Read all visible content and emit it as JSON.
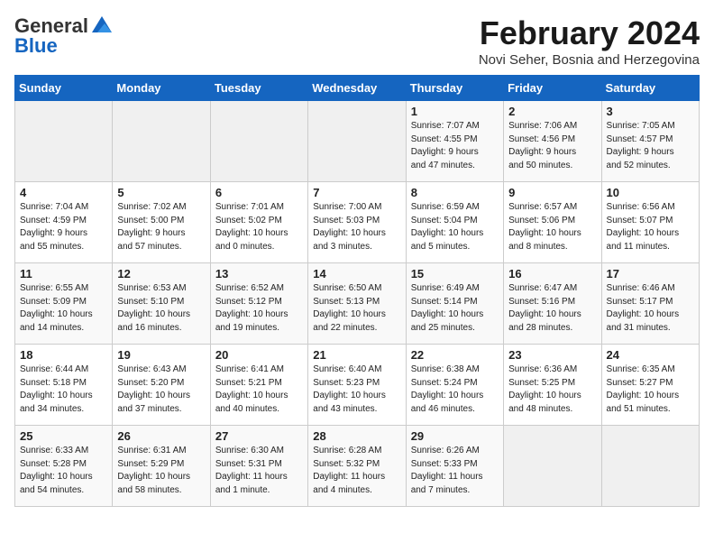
{
  "header": {
    "logo_general": "General",
    "logo_blue": "Blue",
    "month_title": "February 2024",
    "location": "Novi Seher, Bosnia and Herzegovina"
  },
  "days_of_week": [
    "Sunday",
    "Monday",
    "Tuesday",
    "Wednesday",
    "Thursday",
    "Friday",
    "Saturday"
  ],
  "weeks": [
    [
      {
        "day": "",
        "info": ""
      },
      {
        "day": "",
        "info": ""
      },
      {
        "day": "",
        "info": ""
      },
      {
        "day": "",
        "info": ""
      },
      {
        "day": "1",
        "info": "Sunrise: 7:07 AM\nSunset: 4:55 PM\nDaylight: 9 hours\nand 47 minutes."
      },
      {
        "day": "2",
        "info": "Sunrise: 7:06 AM\nSunset: 4:56 PM\nDaylight: 9 hours\nand 50 minutes."
      },
      {
        "day": "3",
        "info": "Sunrise: 7:05 AM\nSunset: 4:57 PM\nDaylight: 9 hours\nand 52 minutes."
      }
    ],
    [
      {
        "day": "4",
        "info": "Sunrise: 7:04 AM\nSunset: 4:59 PM\nDaylight: 9 hours\nand 55 minutes."
      },
      {
        "day": "5",
        "info": "Sunrise: 7:02 AM\nSunset: 5:00 PM\nDaylight: 9 hours\nand 57 minutes."
      },
      {
        "day": "6",
        "info": "Sunrise: 7:01 AM\nSunset: 5:02 PM\nDaylight: 10 hours\nand 0 minutes."
      },
      {
        "day": "7",
        "info": "Sunrise: 7:00 AM\nSunset: 5:03 PM\nDaylight: 10 hours\nand 3 minutes."
      },
      {
        "day": "8",
        "info": "Sunrise: 6:59 AM\nSunset: 5:04 PM\nDaylight: 10 hours\nand 5 minutes."
      },
      {
        "day": "9",
        "info": "Sunrise: 6:57 AM\nSunset: 5:06 PM\nDaylight: 10 hours\nand 8 minutes."
      },
      {
        "day": "10",
        "info": "Sunrise: 6:56 AM\nSunset: 5:07 PM\nDaylight: 10 hours\nand 11 minutes."
      }
    ],
    [
      {
        "day": "11",
        "info": "Sunrise: 6:55 AM\nSunset: 5:09 PM\nDaylight: 10 hours\nand 14 minutes."
      },
      {
        "day": "12",
        "info": "Sunrise: 6:53 AM\nSunset: 5:10 PM\nDaylight: 10 hours\nand 16 minutes."
      },
      {
        "day": "13",
        "info": "Sunrise: 6:52 AM\nSunset: 5:12 PM\nDaylight: 10 hours\nand 19 minutes."
      },
      {
        "day": "14",
        "info": "Sunrise: 6:50 AM\nSunset: 5:13 PM\nDaylight: 10 hours\nand 22 minutes."
      },
      {
        "day": "15",
        "info": "Sunrise: 6:49 AM\nSunset: 5:14 PM\nDaylight: 10 hours\nand 25 minutes."
      },
      {
        "day": "16",
        "info": "Sunrise: 6:47 AM\nSunset: 5:16 PM\nDaylight: 10 hours\nand 28 minutes."
      },
      {
        "day": "17",
        "info": "Sunrise: 6:46 AM\nSunset: 5:17 PM\nDaylight: 10 hours\nand 31 minutes."
      }
    ],
    [
      {
        "day": "18",
        "info": "Sunrise: 6:44 AM\nSunset: 5:18 PM\nDaylight: 10 hours\nand 34 minutes."
      },
      {
        "day": "19",
        "info": "Sunrise: 6:43 AM\nSunset: 5:20 PM\nDaylight: 10 hours\nand 37 minutes."
      },
      {
        "day": "20",
        "info": "Sunrise: 6:41 AM\nSunset: 5:21 PM\nDaylight: 10 hours\nand 40 minutes."
      },
      {
        "day": "21",
        "info": "Sunrise: 6:40 AM\nSunset: 5:23 PM\nDaylight: 10 hours\nand 43 minutes."
      },
      {
        "day": "22",
        "info": "Sunrise: 6:38 AM\nSunset: 5:24 PM\nDaylight: 10 hours\nand 46 minutes."
      },
      {
        "day": "23",
        "info": "Sunrise: 6:36 AM\nSunset: 5:25 PM\nDaylight: 10 hours\nand 48 minutes."
      },
      {
        "day": "24",
        "info": "Sunrise: 6:35 AM\nSunset: 5:27 PM\nDaylight: 10 hours\nand 51 minutes."
      }
    ],
    [
      {
        "day": "25",
        "info": "Sunrise: 6:33 AM\nSunset: 5:28 PM\nDaylight: 10 hours\nand 54 minutes."
      },
      {
        "day": "26",
        "info": "Sunrise: 6:31 AM\nSunset: 5:29 PM\nDaylight: 10 hours\nand 58 minutes."
      },
      {
        "day": "27",
        "info": "Sunrise: 6:30 AM\nSunset: 5:31 PM\nDaylight: 11 hours\nand 1 minute."
      },
      {
        "day": "28",
        "info": "Sunrise: 6:28 AM\nSunset: 5:32 PM\nDaylight: 11 hours\nand 4 minutes."
      },
      {
        "day": "29",
        "info": "Sunrise: 6:26 AM\nSunset: 5:33 PM\nDaylight: 11 hours\nand 7 minutes."
      },
      {
        "day": "",
        "info": ""
      },
      {
        "day": "",
        "info": ""
      }
    ]
  ]
}
